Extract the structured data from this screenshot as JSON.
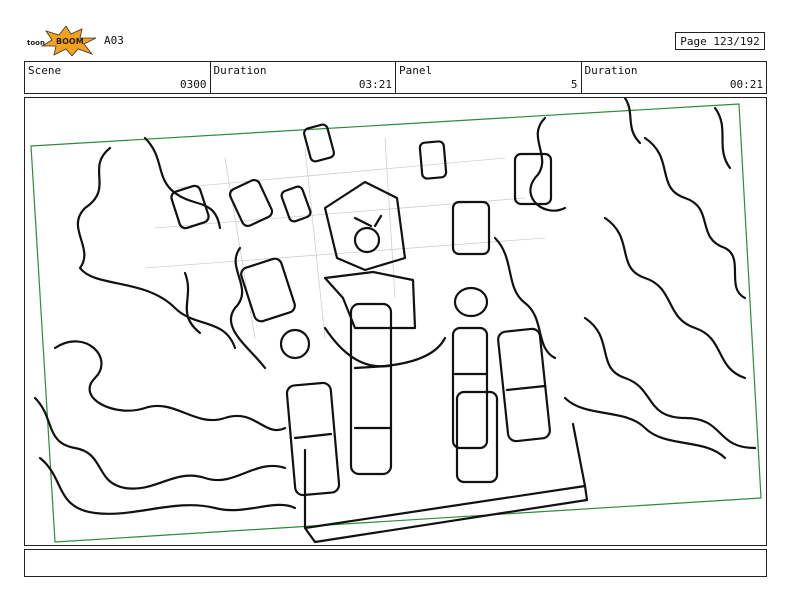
{
  "header": {
    "project_code": "A03",
    "page_label": "Page 123/192"
  },
  "info_bar": {
    "scene": {
      "label": "Scene",
      "value": "0300"
    },
    "scene_duration": {
      "label": "Duration",
      "value": "03:21"
    },
    "panel": {
      "label": "Panel",
      "value": "5"
    },
    "panel_duration": {
      "label": "Duration",
      "value": "00:21"
    }
  },
  "drawing": {
    "description_icon": "storyboard-sketch-image",
    "camera_frame_color": "#2e8b3a"
  },
  "notes": {
    "text": ""
  }
}
